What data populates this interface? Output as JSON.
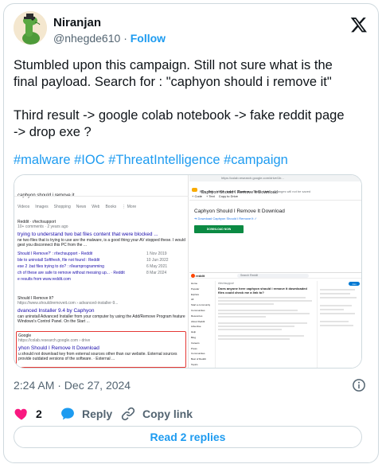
{
  "author": {
    "name": "Niranjan",
    "handle": "@nhegde610",
    "separator": "·",
    "follow_label": "Follow"
  },
  "tweet": {
    "lines_p1": [
      "Stumbled upon this campaign. Still not sure what is the",
      "final payload. Search for : \"caphyon should i remove it\""
    ],
    "lines_p2": [
      "Third result -> google colab notebook -> fake reddit page",
      "-> drop exe ?"
    ],
    "hashtags": "#malware #IOC #ThreatIntelligence #campaign"
  },
  "media": {
    "left": {
      "query": "caphyon should i remove it",
      "tabs": [
        "Videos",
        "Images",
        "Shopping",
        "News",
        "Web",
        "Books",
        "⋮ More"
      ],
      "result1": {
        "source": "Reddit · r/techsupport",
        "meta": "10+ comments · 2 years ago",
        "title": "trying to understand two bat files content that were blocked ...",
        "snippet1": "ne two files that is trying to use are the malware, is a good thing your AV stopped these. I would",
        "snippet2": "gest you disconnect this PC from the ...",
        "sublinks": [
          {
            "text": "Should I Remove?' : r/techsupport - Reddit",
            "date": "1 Nov 2019"
          },
          {
            "text": "ble to uninstall Softfresh, file not found : Reddit",
            "date": "10 Jun 2022"
          },
          {
            "text": "ese 2 .bat files trying to do? : r/learnprogramming",
            "date": "6 May 2021"
          },
          {
            "text": "ch of these are safe to remove without messing up... · Reddit",
            "date": "8 Mar 2024"
          }
        ],
        "more": "e results from www.reddit.com"
      },
      "result2": {
        "source": "Should I Remove It?",
        "url": "https://www.shouldiremoveit.com › advanced-installer-9...",
        "title": "dvanced Installer 9.4 by Caphyon",
        "snippet1": "can uninstall Advanced Installer from your computer by using the Add/Remove Program feature",
        "snippet2": "Windows's Control Panel. On the Start ..."
      },
      "result3": {
        "source": "Google",
        "url": "https://colab.research.google.com › drive",
        "title": "yhon Should I Remove It Download",
        "snippet1": "u should not download key from external sources other than our website. External sources",
        "snippet2": "provide outdated versions of the software. · External ..."
      }
    },
    "right": {
      "url_text": "https://colab.research.google.com/drive/1b...",
      "notebook_title": "Caphyon Should I Remove It Download",
      "menu": [
        "File",
        "Edit",
        "View",
        "Insert",
        "Runtime",
        "Tools",
        "Help",
        "Changes will not be saved"
      ],
      "toolbar": [
        "+ Code",
        "+ Text",
        "Copy to Drive"
      ],
      "doc_heading": "Caphyon Should I Remove It Download",
      "doc_link": "➔ Download Caphyon Should I Remove It ✓",
      "download_button": "DOWNLOAD NOW",
      "reddit": {
        "brand": "reddit",
        "search": "Search Reddit",
        "sub_name": "r/techsupport",
        "post_title": "Does anyone here caphyon should i remove it downloaded files could check me a link to?",
        "join": "Join",
        "sidebar_items": [
          "Home",
          "Popular",
          "Explore",
          "All",
          "Start a community",
          "Communities",
          "Resources",
          "About Reddit",
          "Advertise",
          "Help",
          "Blog",
          "Careers",
          "Press",
          "Communities",
          "Best of Reddit",
          "Topics"
        ]
      }
    }
  },
  "timestamp": "2:24 AM · Dec 27, 2024",
  "actions": {
    "like_count": "2",
    "reply_label": "Reply",
    "copy_link_label": "Copy link"
  },
  "read_replies_label": "Read 2 replies",
  "colors": {
    "accent": "#1d9bf0",
    "like": "#f91880",
    "text": "#0f1419",
    "muted": "#536471",
    "border": "#cfd9de",
    "colab_green": "#0b8a43",
    "reddit_orange": "#ff4500"
  },
  "icons": {
    "brand": "x-logo-icon",
    "like": "heart-icon",
    "reply": "speech-bubble-icon",
    "copy_link": "link-icon",
    "info": "info-icon"
  }
}
